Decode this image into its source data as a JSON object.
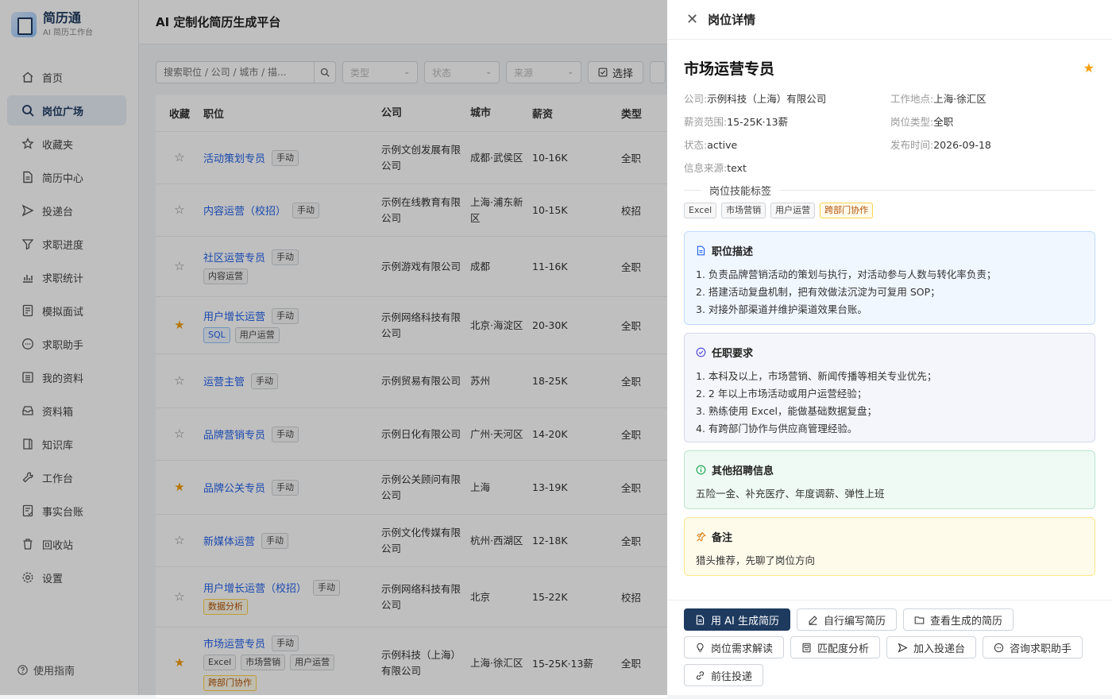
{
  "app": {
    "name": "简历通",
    "subtitle": "AI 简历工作台"
  },
  "sidebar": {
    "items": [
      {
        "label": "首页",
        "icon": "home-icon"
      },
      {
        "label": "岗位广场",
        "icon": "search-icon",
        "active": true
      },
      {
        "label": "收藏夹",
        "icon": "star-icon"
      },
      {
        "label": "简历中心",
        "icon": "document-icon"
      },
      {
        "label": "投递台",
        "icon": "send-icon"
      },
      {
        "label": "求职进度",
        "icon": "filter-icon"
      },
      {
        "label": "求职统计",
        "icon": "bar-chart-icon"
      },
      {
        "label": "模拟面试",
        "icon": "interview-icon"
      },
      {
        "label": "求职助手",
        "icon": "chat-icon"
      },
      {
        "label": "我的资料",
        "icon": "profile-icon"
      },
      {
        "label": "资料箱",
        "icon": "inbox-icon"
      },
      {
        "label": "知识库",
        "icon": "book-icon"
      },
      {
        "label": "工作台",
        "icon": "wrench-icon"
      },
      {
        "label": "事实台账",
        "icon": "ledger-icon"
      },
      {
        "label": "回收站",
        "icon": "trash-icon"
      },
      {
        "label": "设置",
        "icon": "gear-icon"
      }
    ],
    "guide": "使用指南"
  },
  "header": {
    "title": "AI 定制化简历生成平台"
  },
  "filters": {
    "search_placeholder": "搜索职位 / 公司 / 城市 / 描...",
    "type": "类型",
    "status": "状态",
    "source": "来源",
    "select": "选择"
  },
  "table": {
    "columns": [
      "收藏",
      "职位",
      "公司",
      "城市",
      "薪资",
      "类型"
    ],
    "rows": [
      {
        "starred": false,
        "title": "活动策划专员",
        "badge": "手动",
        "tags": [],
        "company": "示例文创发展有限公司",
        "city": "成都·武侯区",
        "salary": "10-16K",
        "type": "全职"
      },
      {
        "starred": false,
        "title": "内容运营（校招）",
        "badge": "手动",
        "tags": [],
        "company": "示例在线教育有限公司",
        "city": "上海·浦东新区",
        "salary": "10-15K",
        "type": "校招"
      },
      {
        "starred": false,
        "title": "社区运营专员",
        "badge": "手动",
        "tags": [
          {
            "text": "内容运营",
            "style": "gray"
          }
        ],
        "company": "示例游戏有限公司",
        "city": "成都",
        "salary": "11-16K",
        "type": "全职"
      },
      {
        "starred": true,
        "title": "用户增长运营",
        "badge": "手动",
        "tags": [
          {
            "text": "SQL",
            "style": "blue"
          },
          {
            "text": "用户运营",
            "style": "gray"
          }
        ],
        "company": "示例网络科技有限公司",
        "city": "北京·海淀区",
        "salary": "20-30K",
        "type": "全职"
      },
      {
        "starred": false,
        "title": "运营主管",
        "badge": "手动",
        "tags": [],
        "company": "示例贸易有限公司",
        "city": "苏州",
        "salary": "18-25K",
        "type": "全职"
      },
      {
        "starred": false,
        "title": "品牌营销专员",
        "badge": "手动",
        "tags": [],
        "company": "示例日化有限公司",
        "city": "广州·天河区",
        "salary": "14-20K",
        "type": "全职"
      },
      {
        "starred": true,
        "title": "品牌公关专员",
        "badge": "手动",
        "tags": [],
        "company": "示例公关顾问有限公司",
        "city": "上海",
        "salary": "13-19K",
        "type": "全职"
      },
      {
        "starred": false,
        "title": "新媒体运营",
        "badge": "手动",
        "tags": [],
        "company": "示例文化传媒有限公司",
        "city": "杭州·西湖区",
        "salary": "12-18K",
        "type": "全职"
      },
      {
        "starred": false,
        "title": "用户增长运营（校招）",
        "badge": "手动",
        "tags": [
          {
            "text": "数据分析",
            "style": "orange"
          }
        ],
        "company": "示例网络科技有限公司",
        "city": "北京",
        "salary": "15-22K",
        "type": "校招"
      },
      {
        "starred": true,
        "title": "市场运营专员",
        "badge": "手动",
        "tags": [
          {
            "text": "Excel",
            "style": "gray"
          },
          {
            "text": "市场营销",
            "style": "gray"
          },
          {
            "text": "用户运营",
            "style": "gray"
          },
          {
            "text": "跨部门协作",
            "style": "orange"
          }
        ],
        "company": "示例科技（上海）有限公司",
        "city": "上海·徐汇区",
        "salary": "15-25K·13薪",
        "type": "全职"
      }
    ]
  },
  "drawer": {
    "header": "岗位详情",
    "title": "市场运营专员",
    "starred": true,
    "meta": [
      {
        "k": "公司:",
        "v": "示例科技（上海）有限公司"
      },
      {
        "k": "工作地点:",
        "v": "上海·徐汇区"
      },
      {
        "k": "薪资范围:",
        "v": "15-25K·13薪"
      },
      {
        "k": "岗位类型:",
        "v": "全职"
      },
      {
        "k": "状态:",
        "v": "active"
      },
      {
        "k": "发布时间:",
        "v": "2026-09-18"
      },
      {
        "k": "信息来源:",
        "v": "text"
      }
    ],
    "skills_label": "岗位技能标签",
    "skills": [
      {
        "text": "Excel",
        "style": "gray"
      },
      {
        "text": "市场营销",
        "style": "gray"
      },
      {
        "text": "用户运营",
        "style": "gray"
      },
      {
        "text": "跨部门协作",
        "style": "orange"
      }
    ],
    "description": {
      "title": "职位描述",
      "lines": [
        "1. 负责品牌营销活动的策划与执行，对活动参与人数与转化率负责；",
        "2. 搭建活动复盘机制，把有效做法沉淀为可复用 SOP；",
        "3. 对接外部渠道并维护渠道效果台账。"
      ]
    },
    "requirements": {
      "title": "任职要求",
      "lines": [
        "1. 本科及以上，市场营销、新闻传播等相关专业优先；",
        "2. 2 年以上市场活动或用户运营经验；",
        "3. 熟练使用 Excel，能做基础数据复盘；",
        "4. 有跨部门协作与供应商管理经验。"
      ]
    },
    "other": {
      "title": "其他招聘信息",
      "text": "五险一金、补充医疗、年度调薪、弹性上班"
    },
    "note": {
      "title": "备注",
      "text": "猎头推荐，先聊了岗位方向"
    },
    "actions": [
      {
        "label": "用 AI 生成简历",
        "icon": "document-icon",
        "primary": true
      },
      {
        "label": "自行编写简历",
        "icon": "pencil-icon"
      },
      {
        "label": "查看生成的简历",
        "icon": "folder-icon"
      },
      {
        "label": "岗位需求解读",
        "icon": "lightbulb-icon"
      },
      {
        "label": "匹配度分析",
        "icon": "report-icon"
      },
      {
        "label": "加入投递台",
        "icon": "send-icon"
      },
      {
        "label": "咨询求职助手",
        "icon": "chat-icon"
      },
      {
        "label": "前往投递",
        "icon": "link-icon"
      }
    ]
  }
}
